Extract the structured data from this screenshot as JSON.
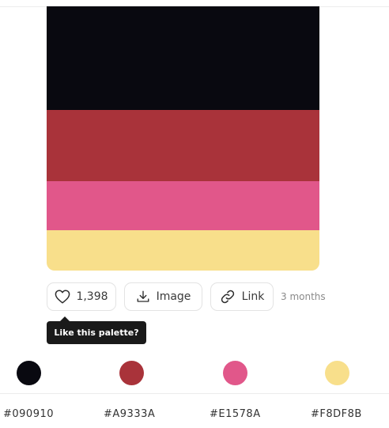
{
  "palette": {
    "colors": [
      {
        "hex_label": "#090910",
        "value": "#090910"
      },
      {
        "hex_label": "#A9333A",
        "value": "#A9333A"
      },
      {
        "hex_label": "#E1578A",
        "value": "#E1578A"
      },
      {
        "hex_label": "#F8DF8B",
        "value": "#F8DF8B"
      }
    ]
  },
  "actions": {
    "like_count": "1,398",
    "image_label": "Image",
    "link_label": "Link",
    "age": "3 months"
  },
  "tooltip": {
    "text": "Like this palette?"
  },
  "icons": {
    "like": "heart-icon",
    "image": "download-icon",
    "link": "link-icon"
  }
}
